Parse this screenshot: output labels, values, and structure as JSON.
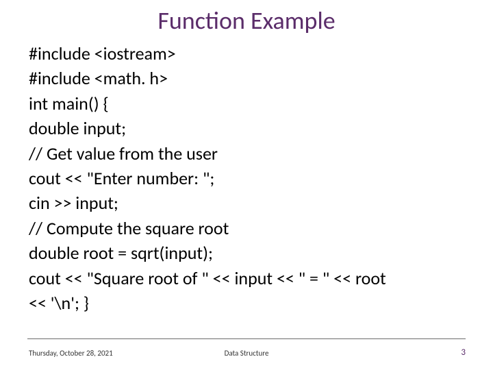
{
  "title": "Function Example",
  "code_lines": [
    "#include <iostream>",
    "#include <math. h>",
    "int main() {",
    "double input;",
    "// Get value from the user",
    "cout << \"Enter number: \";",
    "cin >> input;",
    "// Compute the square root",
    "double root = sqrt(input);",
    "cout << \"Square root of \" << input << \" = \" << root",
    "<< '\\n'; }"
  ],
  "footer": {
    "date": "Thursday, October 28, 2021",
    "center": "Data Structure",
    "page": "3"
  }
}
